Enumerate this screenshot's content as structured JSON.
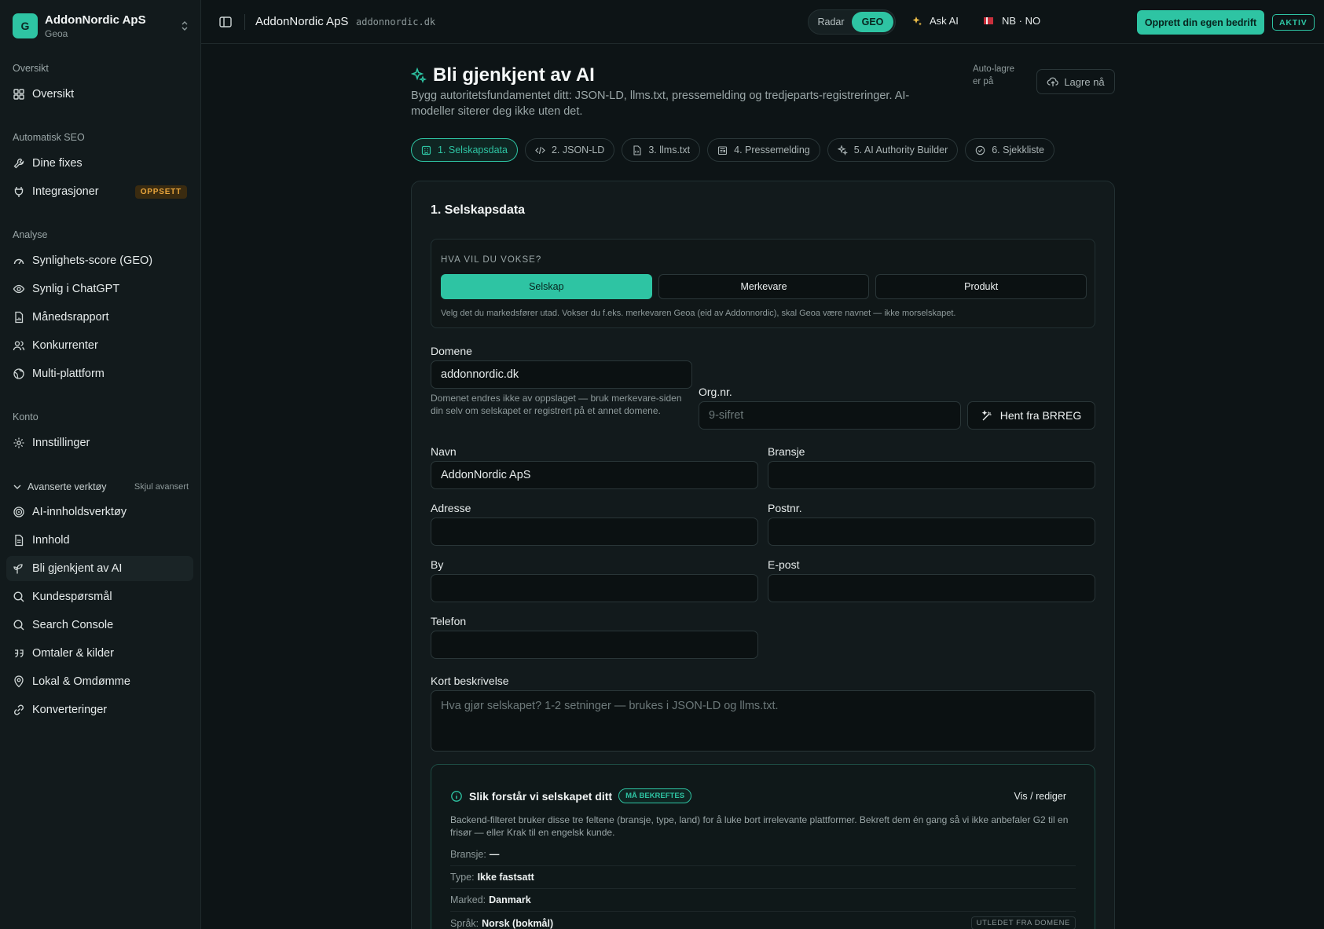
{
  "workspace": {
    "initial": "G",
    "name": "AddonNordic ApS",
    "sub": "Geoa"
  },
  "nav": {
    "sec_overview": "Oversikt",
    "overview": "Oversikt",
    "sec_auto": "Automatisk SEO",
    "fixes": "Dine fixes",
    "integrations": "Integrasjoner",
    "integrations_badge": "OPPSETT",
    "sec_analysis": "Analyse",
    "geo_score": "Synlighets-score (GEO)",
    "chatgpt": "Synlig i ChatGPT",
    "monthly": "Månedsrapport",
    "competitors": "Konkurrenter",
    "multi": "Multi-plattform",
    "sec_account": "Konto",
    "settings": "Innstillinger",
    "advanced": "Avanserte verktøy",
    "hide_advanced": "Skjul avansert",
    "ai_tools": "AI-innholdsverktøy",
    "content": "Innhold",
    "recognized": "Bli gjenkjent av AI",
    "questions": "Kundespørsmål",
    "search_console": "Search Console",
    "mentions": "Omtaler & kilder",
    "local": "Lokal & Omdømme",
    "conversions": "Konverteringer"
  },
  "topbar": {
    "title": "AddonNordic ApS",
    "domain": "addonnordic.dk",
    "seg_radar": "Radar",
    "seg_geo": "GEO",
    "ask_ai": "Ask AI",
    "lang": "NB · NO",
    "cta": "Opprett din egen bedrift",
    "status": "AKTIV"
  },
  "page": {
    "title": "Bli gjenkjent av AI",
    "desc": "Bygg autoritetsfundamentet ditt: JSON-LD, llms.txt, pressemelding og tredjeparts-registreringer. AI-modeller siterer deg ikke uten det.",
    "autosave": "Auto-lagre er på",
    "save": "Lagre nå",
    "tabs": [
      "1. Selskapsdata",
      "2. JSON-LD",
      "3. llms.txt",
      "4. Pressemelding",
      "5. AI Authority Builder",
      "6. Sjekkliste"
    ]
  },
  "form": {
    "card_title": "1. Selskapsdata",
    "grow_question": "HVA VIL DU VOKSE?",
    "grow_options": [
      "Selskap",
      "Merkevare",
      "Produkt"
    ],
    "grow_help": "Velg det du markedsfører utad. Vokser du f.eks. merkevaren Geoa (eid av Addonnordic), skal Geoa være navnet — ikke morselskapet.",
    "domain_label": "Domene",
    "domain_value": "addonnordic.dk",
    "domain_help": "Domenet endres ikke av oppslaget — bruk merkevare-siden din selv om selskapet er registrert på et annet domene.",
    "org_label": "Org.nr.",
    "org_placeholder": "9-sifret",
    "brreg": "Hent fra BRREG",
    "name_label": "Navn",
    "name_value": "AddonNordic ApS",
    "industry_label": "Bransje",
    "address_label": "Adresse",
    "postal_label": "Postnr.",
    "city_label": "By",
    "email_label": "E-post",
    "phone_label": "Telefon",
    "desc_label": "Kort beskrivelse",
    "desc_placeholder": "Hva gjør selskapet? 1-2 setninger — brukes i JSON-LD og llms.txt."
  },
  "understanding": {
    "title": "Slik forstår vi selskapet ditt",
    "badge": "MÅ BEKREFTES",
    "edit": "Vis / rediger",
    "desc": "Backend-filteret bruker disse tre feltene (bransje, type, land) for å luke bort irrelevante plattformer. Bekreft dem én gang så vi ikke anbefaler G2 til en frisør — eller Krak til en engelsk kunde.",
    "industry_key": "Bransje:",
    "industry_val": "—",
    "type_key": "Type:",
    "type_val": "Ikke fastsatt",
    "market_key": "Marked:",
    "market_val": "Danmark",
    "lang_key": "Språk:",
    "lang_val": "Norsk (bokmål)",
    "lang_tag": "UTLEDET FRA DOMENE"
  }
}
